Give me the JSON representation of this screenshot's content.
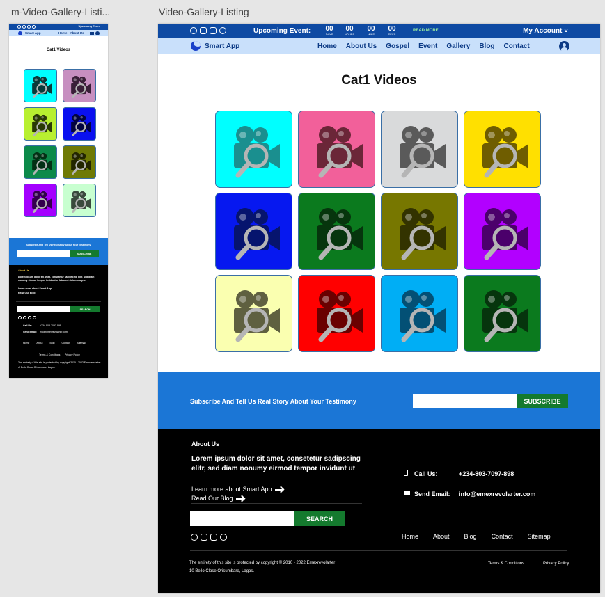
{
  "artboards": {
    "mobile_label": "m-Video-Gallery-Listi...",
    "desktop_label": "Video-Gallery-Listing"
  },
  "topbar": {
    "event_label": "Upcoming Event:",
    "countdown": [
      {
        "value": "00",
        "unit": "DAYS"
      },
      {
        "value": "00",
        "unit": "HOURS"
      },
      {
        "value": "00",
        "unit": "MINS"
      },
      {
        "value": "00",
        "unit": "SECS"
      }
    ],
    "read_more": "READ MORE",
    "account": "My Account ˅",
    "social_icons": [
      "facebook-icon",
      "youtube-icon",
      "instagram-icon",
      "whatsapp-icon"
    ]
  },
  "navbar": {
    "brand": "Smart App",
    "items": [
      "Home",
      "About Us",
      "Gospel",
      "Event",
      "Gallery",
      "Blog",
      "Contact"
    ]
  },
  "page": {
    "title": "Cat1 Videos"
  },
  "gallery": {
    "icon": "video-camera-search-icon",
    "tiles": [
      {
        "bg": "#00ffff",
        "fg": "#1a8f8f"
      },
      {
        "bg": "#f2609a",
        "fg": "#6b2638"
      },
      {
        "bg": "#d9dadb",
        "fg": "#5a5a5a"
      },
      {
        "bg": "#ffe000",
        "fg": "#6f5d00"
      },
      {
        "bg": "#0618f0",
        "fg": "#06146e"
      },
      {
        "bg": "#0b7a1e",
        "fg": "#06350d"
      },
      {
        "bg": "#777700",
        "fg": "#333300"
      },
      {
        "bg": "#b200ff",
        "fg": "#4b006b"
      },
      {
        "bg": "#faffb0",
        "fg": "#5f6040"
      },
      {
        "bg": "#ff0000",
        "fg": "#6a0000"
      },
      {
        "bg": "#00aef5",
        "fg": "#035075"
      },
      {
        "bg": "#0b7a1e",
        "fg": "#06350d"
      }
    ],
    "mobile_tiles": [
      {
        "bg": "#00ffff",
        "fg": "#0a3a3a"
      },
      {
        "bg": "#c78fc0",
        "fg": "#3a1f38"
      },
      {
        "bg": "#b8f030",
        "fg": "#2a3a05"
      },
      {
        "bg": "#0a10f0",
        "fg": "#020440"
      },
      {
        "bg": "#0c8a4a",
        "fg": "#033015"
      },
      {
        "bg": "#6f7a05",
        "fg": "#222500"
      },
      {
        "bg": "#a400ff",
        "fg": "#33004d"
      },
      {
        "bg": "#c8ffd0",
        "fg": "#3a4a3d"
      }
    ]
  },
  "subscribe": {
    "text": "Subscribe And Tell Us Real Story About Your Testimony",
    "input_value": "",
    "button": "SUBSCRIBE"
  },
  "footer": {
    "about_heading": "About Us",
    "about_text": "Lorem ipsum dolor sit amet, consetetur sadipscing elitr, sed diam nonumy eirmod tempor invidunt ut",
    "mobile_about_text": "Lorem ipsum dolor sit amet, consetetur sadipscing elitr, sed diam nonumy eirmod tempor invidunt ut laboreet dolore magna",
    "links": [
      "Learn more about Smart App",
      "Read Our Blog"
    ],
    "search_value": "",
    "search_button": "SEARCH",
    "call_label": "Call Us:",
    "call_value": "+234-803-7097-898",
    "email_label": "Send Email:",
    "email_value": "info@emexrevolarter.com",
    "nav": [
      "Home",
      "About",
      "Blog",
      "Contact",
      "Sitemap"
    ],
    "copyright": "The entirety of this site is protected by copyright © 2010 - 2022 Emexrevolarter",
    "mobile_copyright": "The entirety of this site is protected by copyright 2010 - 2022 Emexrevolarter",
    "address": "10 Bello Close Orisumbare, Lagos.",
    "mobile_address": "of Bello Close Orisumbare, Lagos.",
    "terms": "Terms & Conditions",
    "privacy": "Privacy Policy"
  },
  "mobile": {
    "event_label": "Upcoming Event",
    "nav_items": [
      "Home",
      "About Us"
    ],
    "title": "Cat1 Videos"
  }
}
